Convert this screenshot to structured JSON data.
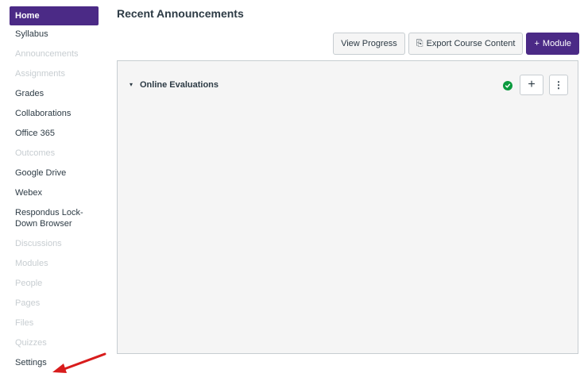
{
  "sidebar": {
    "items": [
      {
        "label": "Home",
        "state": "active"
      },
      {
        "label": "Syllabus",
        "state": "normal"
      },
      {
        "label": "Announcements",
        "state": "disabled"
      },
      {
        "label": "Assignments",
        "state": "disabled"
      },
      {
        "label": "Grades",
        "state": "normal"
      },
      {
        "label": "Collaborations",
        "state": "normal"
      },
      {
        "label": "Office 365",
        "state": "normal"
      },
      {
        "label": "Outcomes",
        "state": "disabled"
      },
      {
        "label": "Google Drive",
        "state": "normal"
      },
      {
        "label": "Webex",
        "state": "normal"
      },
      {
        "label": "Respondus Lock-\nDown Browser",
        "state": "normal"
      },
      {
        "label": "Discussions",
        "state": "disabled"
      },
      {
        "label": "Modules",
        "state": "disabled"
      },
      {
        "label": "People",
        "state": "disabled"
      },
      {
        "label": "Pages",
        "state": "disabled"
      },
      {
        "label": "Files",
        "state": "disabled"
      },
      {
        "label": "Quizzes",
        "state": "disabled"
      },
      {
        "label": "Settings",
        "state": "normal"
      }
    ]
  },
  "header": {
    "title": "Recent Announcements"
  },
  "toolbar": {
    "view_progress_label": "View Progress",
    "export_label": "Export Course Content",
    "export_icon": "export-icon",
    "add_module_label": "Module",
    "add_module_icon": "plus-icon"
  },
  "module": {
    "name": "Online Evaluations",
    "toggle_icon": "collapse-icon",
    "publish_icon": "check-icon",
    "add_icon": "plus-icon",
    "more_icon": "kebab-icon"
  },
  "colors": {
    "accent": "#4b2a86",
    "published": "#0b9a3e",
    "annotation_arrow": "#d81c1c"
  }
}
